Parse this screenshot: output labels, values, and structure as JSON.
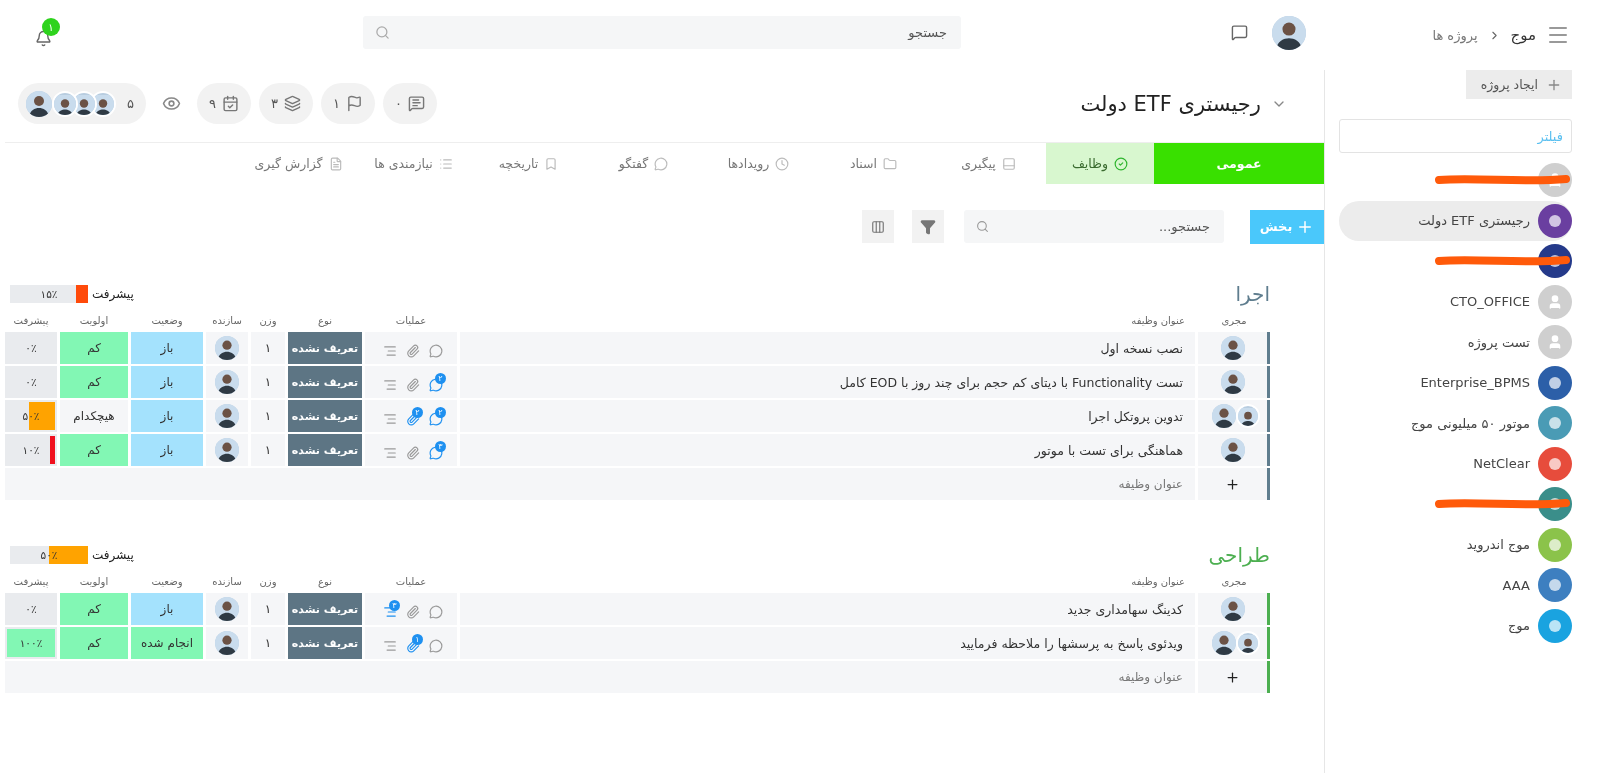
{
  "topbar": {
    "notifications": "۱",
    "search": {
      "placeholder": "جستجو"
    }
  },
  "sidebar": {
    "breadcrumb": [
      "موج",
      "پروژه ها"
    ],
    "create_button": "ایجاد پروژه",
    "filter": {
      "placeholder": "فیلتر"
    },
    "items": [
      {
        "redacted": true,
        "kind": "default",
        "selected": false
      },
      {
        "label": "رجیستری ETF دولت",
        "kind": "logo",
        "selected": true
      },
      {
        "redacted": true,
        "kind": "logo",
        "selected": false
      },
      {
        "label": "CTO_OFFICE",
        "kind": "default",
        "selected": false
      },
      {
        "label": "تست پروژه",
        "kind": "default",
        "selected": false
      },
      {
        "label": "Enterprise_BPMS",
        "kind": "logo",
        "selected": false
      },
      {
        "label": "موتور ۵۰ میلیونی موج",
        "kind": "logo",
        "selected": false
      },
      {
        "label": "NetClear",
        "kind": "logo",
        "selected": false
      },
      {
        "redacted": true,
        "kind": "logo",
        "selected": false
      },
      {
        "label": "موج اندروید",
        "kind": "logo",
        "selected": false
      },
      {
        "label": "AAA",
        "kind": "logo",
        "selected": false
      },
      {
        "label": "موج",
        "kind": "logo",
        "selected": false
      }
    ]
  },
  "project": {
    "title": "رجیستری ETF دولت",
    "stats": [
      {
        "kind": "comments",
        "value": "۰"
      },
      {
        "kind": "flags",
        "value": "۱"
      },
      {
        "kind": "layers",
        "value": "۳"
      },
      {
        "kind": "tasks",
        "value": "۹"
      }
    ],
    "watchers": {
      "count": "۵",
      "avatars": [
        {
          "kind": "photo"
        },
        {
          "kind": "photo"
        },
        {
          "kind": "photo"
        },
        {
          "kind": "photo"
        }
      ]
    }
  },
  "tabs": [
    {
      "label": "عمومی",
      "kind": "primary",
      "selected": false
    },
    {
      "label": "وظایف",
      "kind": "plain",
      "selected": true
    },
    {
      "label": "پیگیری",
      "kind": "plain",
      "selected": false
    },
    {
      "label": "اسناد",
      "kind": "plain",
      "selected": false
    },
    {
      "label": "رویدادها",
      "kind": "plain",
      "selected": false
    },
    {
      "label": "گفتگو",
      "kind": "plain",
      "selected": false
    },
    {
      "label": "تاریخچه",
      "kind": "plain",
      "selected": false
    },
    {
      "label": "نیازمندی ها",
      "kind": "plain",
      "selected": false
    },
    {
      "label": "گزارش گیری",
      "kind": "plain",
      "selected": false
    }
  ],
  "toolbar": {
    "add_button": "بخش",
    "search": {
      "placeholder": "جستجو..."
    }
  },
  "sections": [
    {
      "title": "اجرا",
      "color": "#5f7d8e",
      "progress_label": "پیشرفت",
      "progress": {
        "level": 0.15,
        "reading": "۱۵٪",
        "color": "#ff4a0a"
      },
      "new_task_placeholder": "عنوان وظیفه",
      "columns": [
        "مجری",
        "عنوان وظیفه",
        "عملیات",
        "نوع",
        "وزن",
        "سازنده",
        "وضعیت",
        "اولویت",
        "پیشرفت"
      ],
      "rows": [
        {
          "assignees": [
            {
              "kind": "photo"
            }
          ],
          "title": "نصب نسخه اول",
          "ops": [
            {
              "kind": "comment",
              "active": false
            },
            {
              "kind": "attachment",
              "active": false
            },
            {
              "kind": "description",
              "active": false
            }
          ],
          "type": "تعریف نشده",
          "weight": "۱",
          "status": {
            "label": "باز",
            "color": "#a4e2fd"
          },
          "priority": {
            "label": "کم",
            "color": "#82f7b4"
          },
          "progress": {
            "level": 0,
            "reading": "۰٪"
          }
        },
        {
          "assignees": [
            {
              "kind": "photo"
            }
          ],
          "title": "تست Functionality با دیتای کم حجم برای چند روز با EOD کامل",
          "ops": [
            {
              "kind": "comment",
              "active": true,
              "count": "۲"
            },
            {
              "kind": "attachment",
              "active": false
            },
            {
              "kind": "description",
              "active": false
            }
          ],
          "type": "تعریف نشده",
          "weight": "۱",
          "status": {
            "label": "باز",
            "color": "#a4e2fd"
          },
          "priority": {
            "label": "کم",
            "color": "#82f7b4"
          },
          "progress": {
            "level": 0,
            "reading": "۰٪"
          }
        },
        {
          "assignees": [
            {
              "kind": "photo"
            },
            {
              "kind": "photo"
            }
          ],
          "title": "تدوین پروتکل اجرا",
          "ops": [
            {
              "kind": "comment",
              "active": true,
              "count": "۲"
            },
            {
              "kind": "attachment",
              "active": true,
              "count": "۲"
            },
            {
              "kind": "description",
              "active": false
            }
          ],
          "type": "تعریف نشده",
          "weight": "۱",
          "status": {
            "label": "باز",
            "color": "#a4e2fd"
          },
          "priority": {
            "label": "هیچکدام",
            "color": "#f5f6f8"
          },
          "progress": {
            "level": 0.5,
            "reading": "۵۰٪",
            "color": "#ffa300"
          }
        },
        {
          "assignees": [
            {
              "kind": "photo"
            }
          ],
          "title": "هماهنگی برای تست با موتور",
          "ops": [
            {
              "kind": "comment",
              "active": true,
              "count": "۳"
            },
            {
              "kind": "attachment",
              "active": false
            },
            {
              "kind": "description",
              "active": false
            }
          ],
          "type": "تعریف نشده",
          "weight": "۱",
          "status": {
            "label": "باز",
            "color": "#a4e2fd"
          },
          "priority": {
            "label": "کم",
            "color": "#82f7b4"
          },
          "progress": {
            "level": 0.1,
            "reading": "۱۰٪",
            "color": "#f0101e"
          }
        }
      ]
    },
    {
      "title": "طراحی",
      "color": "#4caf50",
      "progress_label": "پیشرفت",
      "progress": {
        "level": 0.5,
        "reading": "۵۰٪",
        "color": "#ffa300"
      },
      "new_task_placeholder": "عنوان وظیفه",
      "columns": [
        "مجری",
        "عنوان وظیفه",
        "عملیات",
        "نوع",
        "وزن",
        "سازنده",
        "وضعیت",
        "اولویت",
        "پیشرفت"
      ],
      "rows": [
        {
          "assignees": [
            {
              "kind": "photo"
            }
          ],
          "title": "کدینگ سهامداری جدید",
          "ops": [
            {
              "kind": "comment",
              "active": false
            },
            {
              "kind": "attachment",
              "active": false
            },
            {
              "kind": "description",
              "active": true,
              "count": "۳"
            }
          ],
          "type": "تعریف نشده",
          "weight": "۱",
          "status": {
            "label": "باز",
            "color": "#a4e2fd"
          },
          "priority": {
            "label": "کم",
            "color": "#82f7b4"
          },
          "progress": {
            "level": 0,
            "reading": "۰٪"
          }
        },
        {
          "assignees": [
            {
              "kind": "photo"
            },
            {
              "kind": "photo"
            }
          ],
          "title": "ویدئوی پاسخ به پرسشها را ملاحظه فرمایید",
          "ops": [
            {
              "kind": "comment",
              "active": false
            },
            {
              "kind": "attachment",
              "active": true,
              "count": "۱"
            },
            {
              "kind": "description",
              "active": false
            }
          ],
          "type": "تعریف نشده",
          "weight": "۱",
          "status": {
            "label": "انجام شده",
            "color": "#82f7b4"
          },
          "priority": {
            "label": "کم",
            "color": "#82f7b4"
          },
          "progress": {
            "level": 1,
            "reading": "۱۰۰٪",
            "color": "#82f7b4"
          }
        }
      ]
    }
  ]
}
